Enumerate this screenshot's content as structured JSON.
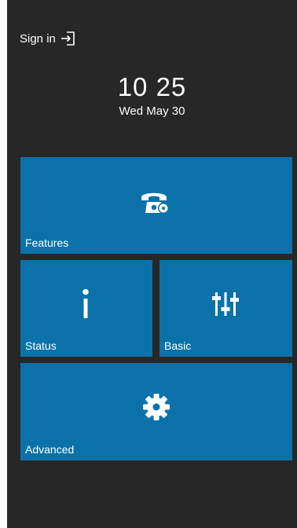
{
  "header": {
    "signin_label": "Sign in",
    "signin_icon": "sign-in-icon"
  },
  "clock": {
    "time": "10 25",
    "date": "Wed May 30"
  },
  "tiles": [
    {
      "label": "Features",
      "icon": "phone-settings-icon"
    },
    {
      "label": "Status",
      "icon": "info-icon"
    },
    {
      "label": "Basic",
      "icon": "sliders-icon"
    },
    {
      "label": "Advanced",
      "icon": "gear-icon"
    }
  ],
  "colors": {
    "background": "#272727",
    "tile": "#0a72a9",
    "text": "#ffffff"
  }
}
